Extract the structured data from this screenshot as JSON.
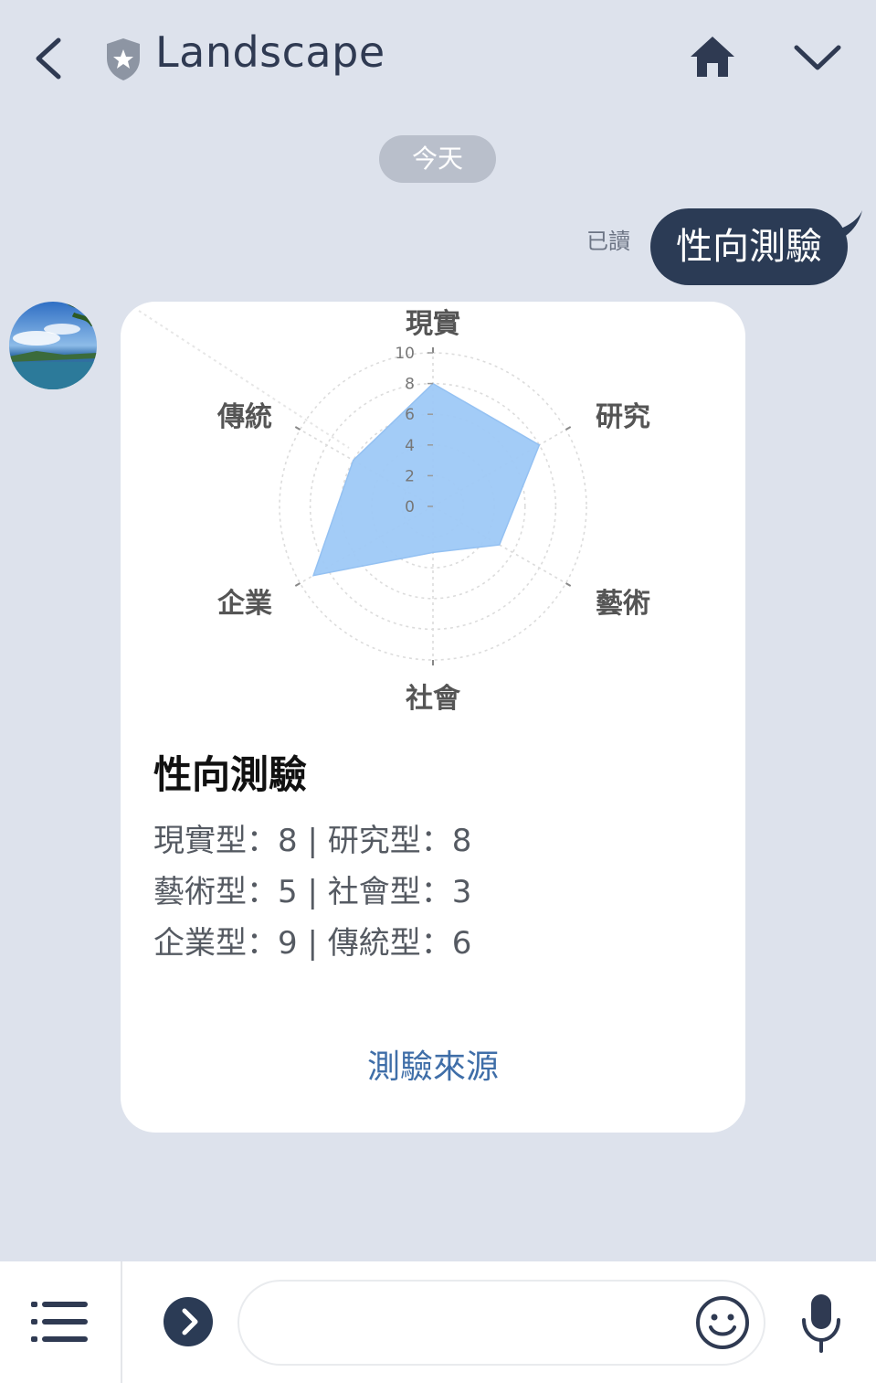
{
  "header": {
    "title": "Landscape",
    "back_icon": "chevron-left-icon",
    "shield_icon": "shield-star-icon",
    "home_icon": "home-icon",
    "more_icon": "chevron-down-icon"
  },
  "date_pill": "今天",
  "sent_message": {
    "text": "性向測驗",
    "read_status": "已讀"
  },
  "card": {
    "title": "性向測驗",
    "lines": [
      "現實型：8 | 研究型：8",
      "藝術型：5 | 社會型：3",
      "企業型：9 | 傳統型：6"
    ],
    "link_label": "測驗來源"
  },
  "chart_data": {
    "type": "radar",
    "axes": [
      "現實",
      "研究",
      "藝術",
      "社會",
      "企業",
      "傳統"
    ],
    "values": [
      8,
      8,
      5,
      3,
      9,
      6
    ],
    "rlim": [
      0,
      10
    ],
    "ticks": [
      "0",
      "2",
      "4",
      "6",
      "8",
      "10"
    ],
    "fill_color": "#9fcaf7",
    "grid": true
  },
  "bottom_bar": {
    "menu_icon": "menu-list-icon",
    "expand_icon": "chevron-right-circle-icon",
    "emoji_icon": "smiley-icon",
    "mic_icon": "microphone-icon"
  },
  "colors": {
    "background": "#dde2ec",
    "sent_bubble": "#2b3b55",
    "link": "#3f6ea8"
  }
}
